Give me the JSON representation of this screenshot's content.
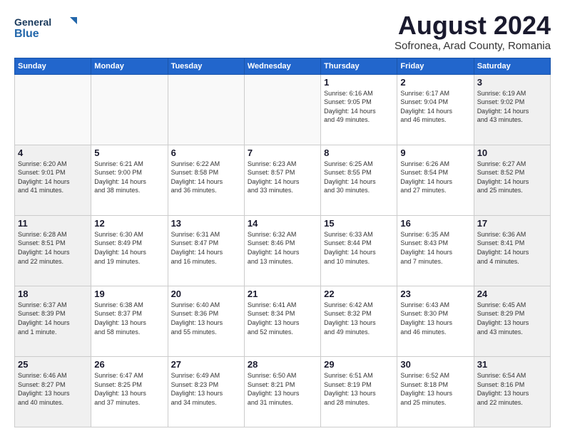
{
  "header": {
    "logo_general": "General",
    "logo_blue": "Blue",
    "month_year": "August 2024",
    "location": "Sofronea, Arad County, Romania"
  },
  "days_of_week": [
    "Sunday",
    "Monday",
    "Tuesday",
    "Wednesday",
    "Thursday",
    "Friday",
    "Saturday"
  ],
  "weeks": [
    [
      {
        "day": "",
        "info": ""
      },
      {
        "day": "",
        "info": ""
      },
      {
        "day": "",
        "info": ""
      },
      {
        "day": "",
        "info": ""
      },
      {
        "day": "1",
        "info": "Sunrise: 6:16 AM\nSunset: 9:05 PM\nDaylight: 14 hours\nand 49 minutes."
      },
      {
        "day": "2",
        "info": "Sunrise: 6:17 AM\nSunset: 9:04 PM\nDaylight: 14 hours\nand 46 minutes."
      },
      {
        "day": "3",
        "info": "Sunrise: 6:19 AM\nSunset: 9:02 PM\nDaylight: 14 hours\nand 43 minutes."
      }
    ],
    [
      {
        "day": "4",
        "info": "Sunrise: 6:20 AM\nSunset: 9:01 PM\nDaylight: 14 hours\nand 41 minutes."
      },
      {
        "day": "5",
        "info": "Sunrise: 6:21 AM\nSunset: 9:00 PM\nDaylight: 14 hours\nand 38 minutes."
      },
      {
        "day": "6",
        "info": "Sunrise: 6:22 AM\nSunset: 8:58 PM\nDaylight: 14 hours\nand 36 minutes."
      },
      {
        "day": "7",
        "info": "Sunrise: 6:23 AM\nSunset: 8:57 PM\nDaylight: 14 hours\nand 33 minutes."
      },
      {
        "day": "8",
        "info": "Sunrise: 6:25 AM\nSunset: 8:55 PM\nDaylight: 14 hours\nand 30 minutes."
      },
      {
        "day": "9",
        "info": "Sunrise: 6:26 AM\nSunset: 8:54 PM\nDaylight: 14 hours\nand 27 minutes."
      },
      {
        "day": "10",
        "info": "Sunrise: 6:27 AM\nSunset: 8:52 PM\nDaylight: 14 hours\nand 25 minutes."
      }
    ],
    [
      {
        "day": "11",
        "info": "Sunrise: 6:28 AM\nSunset: 8:51 PM\nDaylight: 14 hours\nand 22 minutes."
      },
      {
        "day": "12",
        "info": "Sunrise: 6:30 AM\nSunset: 8:49 PM\nDaylight: 14 hours\nand 19 minutes."
      },
      {
        "day": "13",
        "info": "Sunrise: 6:31 AM\nSunset: 8:47 PM\nDaylight: 14 hours\nand 16 minutes."
      },
      {
        "day": "14",
        "info": "Sunrise: 6:32 AM\nSunset: 8:46 PM\nDaylight: 14 hours\nand 13 minutes."
      },
      {
        "day": "15",
        "info": "Sunrise: 6:33 AM\nSunset: 8:44 PM\nDaylight: 14 hours\nand 10 minutes."
      },
      {
        "day": "16",
        "info": "Sunrise: 6:35 AM\nSunset: 8:43 PM\nDaylight: 14 hours\nand 7 minutes."
      },
      {
        "day": "17",
        "info": "Sunrise: 6:36 AM\nSunset: 8:41 PM\nDaylight: 14 hours\nand 4 minutes."
      }
    ],
    [
      {
        "day": "18",
        "info": "Sunrise: 6:37 AM\nSunset: 8:39 PM\nDaylight: 14 hours\nand 1 minute."
      },
      {
        "day": "19",
        "info": "Sunrise: 6:38 AM\nSunset: 8:37 PM\nDaylight: 13 hours\nand 58 minutes."
      },
      {
        "day": "20",
        "info": "Sunrise: 6:40 AM\nSunset: 8:36 PM\nDaylight: 13 hours\nand 55 minutes."
      },
      {
        "day": "21",
        "info": "Sunrise: 6:41 AM\nSunset: 8:34 PM\nDaylight: 13 hours\nand 52 minutes."
      },
      {
        "day": "22",
        "info": "Sunrise: 6:42 AM\nSunset: 8:32 PM\nDaylight: 13 hours\nand 49 minutes."
      },
      {
        "day": "23",
        "info": "Sunrise: 6:43 AM\nSunset: 8:30 PM\nDaylight: 13 hours\nand 46 minutes."
      },
      {
        "day": "24",
        "info": "Sunrise: 6:45 AM\nSunset: 8:29 PM\nDaylight: 13 hours\nand 43 minutes."
      }
    ],
    [
      {
        "day": "25",
        "info": "Sunrise: 6:46 AM\nSunset: 8:27 PM\nDaylight: 13 hours\nand 40 minutes."
      },
      {
        "day": "26",
        "info": "Sunrise: 6:47 AM\nSunset: 8:25 PM\nDaylight: 13 hours\nand 37 minutes."
      },
      {
        "day": "27",
        "info": "Sunrise: 6:49 AM\nSunset: 8:23 PM\nDaylight: 13 hours\nand 34 minutes."
      },
      {
        "day": "28",
        "info": "Sunrise: 6:50 AM\nSunset: 8:21 PM\nDaylight: 13 hours\nand 31 minutes."
      },
      {
        "day": "29",
        "info": "Sunrise: 6:51 AM\nSunset: 8:19 PM\nDaylight: 13 hours\nand 28 minutes."
      },
      {
        "day": "30",
        "info": "Sunrise: 6:52 AM\nSunset: 8:18 PM\nDaylight: 13 hours\nand 25 minutes."
      },
      {
        "day": "31",
        "info": "Sunrise: 6:54 AM\nSunset: 8:16 PM\nDaylight: 13 hours\nand 22 minutes."
      }
    ]
  ]
}
